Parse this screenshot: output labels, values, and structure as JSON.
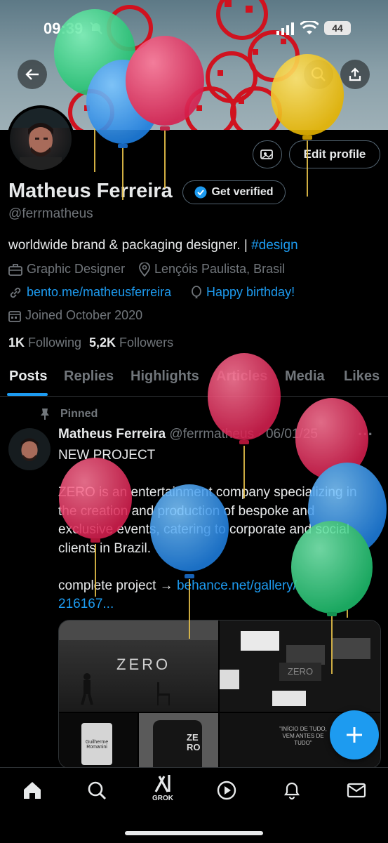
{
  "status_bar": {
    "time": "09:39",
    "battery": "44"
  },
  "profile": {
    "name": "Matheus Ferreira",
    "handle": "@ferrmatheus",
    "get_verified_label": "Get verified",
    "edit_profile_label": "Edit profile",
    "bio_text": "worldwide brand & packaging designer. | ",
    "bio_hashtag": "#design",
    "profession": "Graphic Designer",
    "location": "Lençóis Paulista, Brasil",
    "website": "bento.me/matheusferreira",
    "birthday": "Happy birthday!",
    "joined": "Joined October 2020",
    "following_count": "1K",
    "following_label": "Following",
    "followers_count": "5,2K",
    "followers_label": "Followers"
  },
  "tabs": [
    "Posts",
    "Replies",
    "Highlights",
    "Articles",
    "Media",
    "Likes"
  ],
  "pinned_post": {
    "pinned_label": "Pinned",
    "author_name": "Matheus Ferreira",
    "author_handle": "@ferrmatheus",
    "date": "06/01/25",
    "line1": "NEW PROJECT",
    "line2": "ZERO is an entertainment company specializing in",
    "line3": "the creation and production of bespoke and",
    "line4": "exclusive events, catering to corporate and social",
    "line5": "clients in Brazil.",
    "line6_prefix": "complete project → ",
    "line6_link": "behance.net/gallery/",
    "line7_link": "216167...",
    "images": {
      "img1_text": "ZERO",
      "img2_text": "ZERO",
      "img3_name": "Guilherme Romanini",
      "img4_text": "ZE RO",
      "img5_text": "\"INÍCIO DE TUDO, VEM ANTES DE TUDO\""
    }
  },
  "bottom_nav": {
    "grok_label": "GROK"
  },
  "colors": {
    "accent": "#1d9bf0",
    "background": "#000000",
    "muted": "#71767b",
    "border": "#2f3336"
  }
}
